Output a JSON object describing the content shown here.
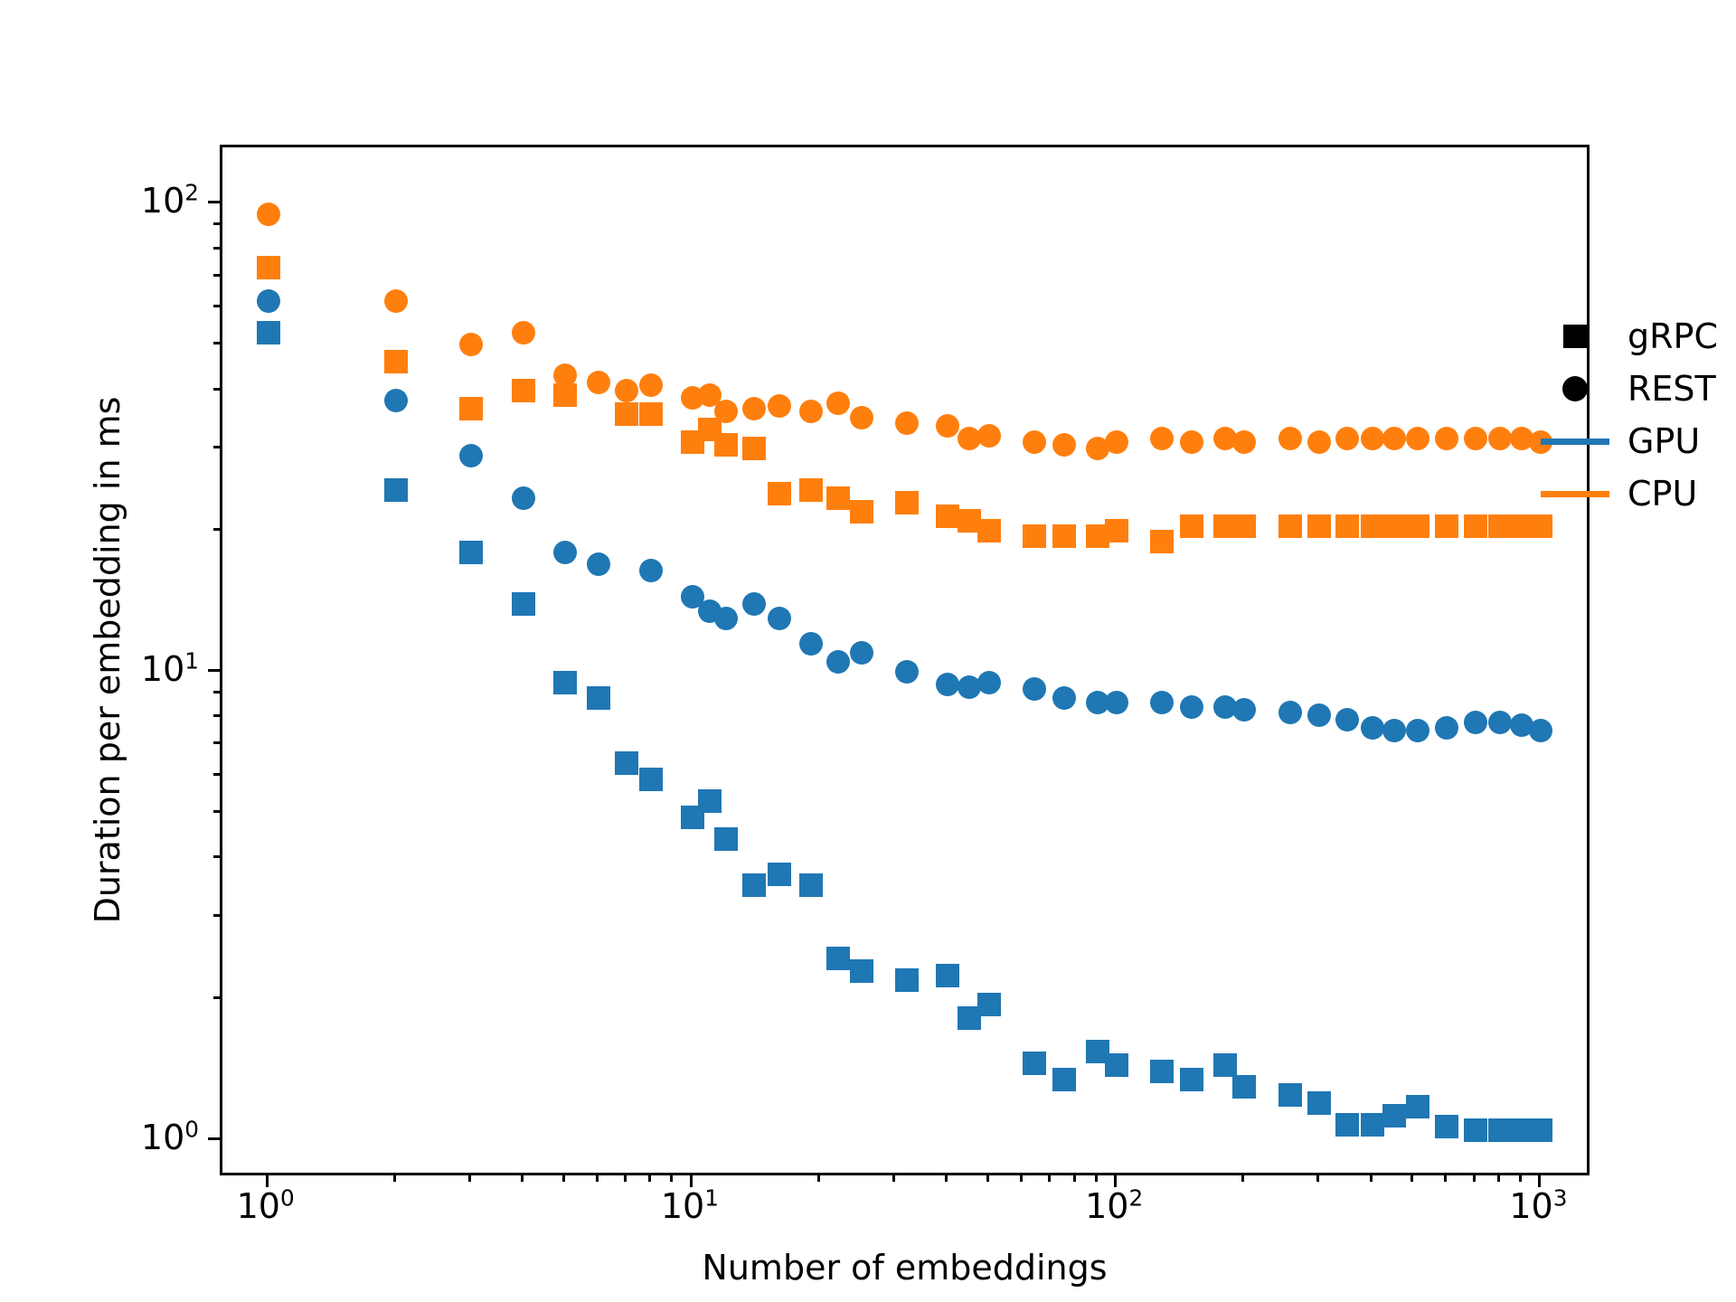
{
  "figure": {
    "background_color": "#ffffff",
    "axes_color": "#000000"
  },
  "axis": {
    "xlabel": "Number of embeddings",
    "ylabel": "Duration per embedding in ms",
    "xticks": [
      {
        "value": 1,
        "label_mantissa": "10",
        "label_exponent": "0"
      },
      {
        "value": 10,
        "label_mantissa": "10",
        "label_exponent": "1"
      },
      {
        "value": 100,
        "label_mantissa": "10",
        "label_exponent": "2"
      },
      {
        "value": 1000,
        "label_mantissa": "10",
        "label_exponent": "3"
      }
    ],
    "yticks": [
      {
        "value": 10,
        "label_mantissa": "10",
        "label_exponent": "1"
      },
      {
        "value": 100,
        "label_mantissa": "10",
        "label_exponent": "2"
      }
    ]
  },
  "legend": {
    "entries": [
      {
        "label": "gRPC",
        "handle": "square-marker",
        "color": "#000000"
      },
      {
        "label": "REST",
        "handle": "circle-marker",
        "color": "#000000"
      },
      {
        "label": "GPU",
        "handle": "line",
        "color": "#1f77b4"
      },
      {
        "label": "CPU",
        "handle": "line",
        "color": "#ff7f0e"
      }
    ]
  },
  "chart_data": {
    "type": "scatter",
    "title": "",
    "xlabel": "Number of embeddings",
    "ylabel": "Duration per embedding in ms",
    "xscale": "log",
    "yscale": "log",
    "xlim": [
      0.78,
      1320
    ],
    "ylim": [
      0.83,
      132
    ],
    "grid": false,
    "legend_position": "upper right",
    "colors": {
      "GPU": "#1f77b4",
      "CPU": "#ff7f0e"
    },
    "markers": {
      "gRPC": "square",
      "REST": "circle"
    },
    "series": [
      {
        "name": "CPU REST",
        "hardware": "CPU",
        "protocol": "REST",
        "color": "#ff7f0e",
        "marker": "circle",
        "x": [
          1,
          2,
          3,
          4,
          5,
          6,
          7,
          8,
          10,
          11,
          12,
          14,
          16,
          19,
          22,
          25,
          32,
          40,
          45,
          50,
          64,
          75,
          90,
          100,
          128,
          150,
          180,
          200,
          256,
          300,
          350,
          400,
          450,
          512,
          600,
          700,
          800,
          900,
          1000
        ],
        "y": [
          95.0,
          62.0,
          50.0,
          53.0,
          43.0,
          41.5,
          40.0,
          41.0,
          38.5,
          39.0,
          36.0,
          36.5,
          37.0,
          36.0,
          37.5,
          35.0,
          34.0,
          33.5,
          31.5,
          32.0,
          31.0,
          30.5,
          30.0,
          31.0,
          31.5,
          31.0,
          31.5,
          31.0,
          31.5,
          31.0,
          31.5,
          31.5,
          31.5,
          31.5,
          31.5,
          31.5,
          31.5,
          31.5,
          31.0
        ]
      },
      {
        "name": "CPU gRPC",
        "hardware": "CPU",
        "protocol": "gRPC",
        "color": "#ff7f0e",
        "marker": "square",
        "x": [
          1,
          2,
          3,
          4,
          5,
          7,
          8,
          10,
          11,
          12,
          14,
          16,
          19,
          22,
          25,
          32,
          40,
          45,
          50,
          64,
          75,
          90,
          100,
          128,
          150,
          180,
          200,
          256,
          300,
          350,
          400,
          450,
          512,
          600,
          700,
          800,
          900,
          1000
        ],
        "y": [
          73.0,
          46.0,
          36.5,
          40.0,
          39.0,
          35.5,
          35.5,
          31.0,
          33.0,
          30.5,
          30.0,
          24.0,
          24.5,
          23.5,
          22.0,
          23.0,
          21.5,
          21.0,
          20.0,
          19.5,
          19.5,
          19.5,
          20.0,
          19.0,
          20.5,
          20.5,
          20.5,
          20.5,
          20.5,
          20.5,
          20.5,
          20.5,
          20.5,
          20.5,
          20.5,
          20.5,
          20.5,
          20.5
        ]
      },
      {
        "name": "GPU REST",
        "hardware": "GPU",
        "protocol": "REST",
        "color": "#1f77b4",
        "marker": "circle",
        "x": [
          1,
          2,
          3,
          4,
          5,
          6,
          8,
          10,
          11,
          12,
          14,
          16,
          19,
          22,
          25,
          32,
          40,
          45,
          50,
          64,
          75,
          90,
          100,
          128,
          150,
          180,
          200,
          256,
          300,
          350,
          400,
          450,
          512,
          600,
          700,
          800,
          900,
          1000
        ],
        "y": [
          62.0,
          38.0,
          29.0,
          23.5,
          18.0,
          17.0,
          16.5,
          14.5,
          13.5,
          13.0,
          14.0,
          13.0,
          11.5,
          10.5,
          11.0,
          10.0,
          9.4,
          9.3,
          9.5,
          9.2,
          8.8,
          8.6,
          8.6,
          8.6,
          8.4,
          8.4,
          8.3,
          8.2,
          8.1,
          7.9,
          7.6,
          7.5,
          7.5,
          7.6,
          7.8,
          7.8,
          7.7,
          7.5
        ]
      },
      {
        "name": "GPU gRPC",
        "hardware": "GPU",
        "protocol": "gRPC",
        "color": "#1f77b4",
        "marker": "square",
        "x": [
          1,
          2,
          3,
          4,
          5,
          6,
          7,
          8,
          10,
          11,
          12,
          14,
          16,
          19,
          22,
          25,
          32,
          40,
          45,
          50,
          64,
          75,
          90,
          100,
          128,
          150,
          180,
          200,
          256,
          300,
          350,
          400,
          450,
          512,
          600,
          700,
          800,
          900,
          1000
        ],
        "y": [
          53.0,
          24.5,
          18.0,
          14.0,
          9.5,
          8.8,
          6.4,
          5.9,
          4.9,
          5.3,
          4.4,
          3.5,
          3.7,
          3.5,
          2.45,
          2.3,
          2.2,
          2.25,
          1.82,
          1.95,
          1.46,
          1.35,
          1.55,
          1.45,
          1.4,
          1.35,
          1.45,
          1.3,
          1.25,
          1.2,
          1.08,
          1.08,
          1.13,
          1.18,
          1.07,
          1.05,
          1.05,
          1.05,
          1.05
        ]
      }
    ]
  }
}
